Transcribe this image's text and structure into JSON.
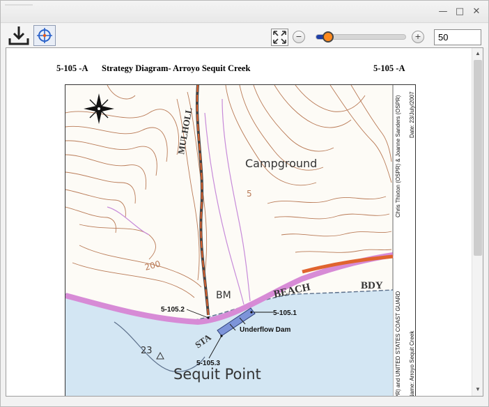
{
  "window": {
    "minimize_icon": "minimize-icon",
    "maximize_icon": "maximize-icon",
    "close_icon": "close-icon"
  },
  "toolbar": {
    "download_icon": "download-icon",
    "target_icon": "crosshair-icon",
    "fit_icon": "fit-to-screen-icon",
    "zoom_out_label": "−",
    "zoom_in_label": "+",
    "zoom_value": "50",
    "zoom_slider_fraction": 0.13
  },
  "document": {
    "header_left": "5-105 -A",
    "title": "Strategy Diagram- Arroyo Sequit Creek",
    "header_right": "5-105 -A"
  },
  "map": {
    "place_campground": "Campground",
    "place_sequit_point": "Sequit Point",
    "road_beach": "BEACH",
    "road_bdy": "BDY",
    "road_mulholland": "MULHOLL",
    "road_state": "STA",
    "bm": "BM",
    "contour_200": "200",
    "contour_23": "23",
    "contour_5": "5",
    "label_5_105_2": "5-105.2",
    "label_5_105_1": "5-105.1",
    "label_5_105_3": "5-105.3",
    "label_dam": "Underflow Dam",
    "side_date": "Date: 23/July/2007",
    "side_authors": "Chris Thixton (OSPR) & Joanne Sanders (OSPR)",
    "side_guard": "PR) and UNITED STATES COAST GUARD",
    "side_name": "Name: Arroyo Sequit Creek",
    "colors": {
      "contour": "#b97a56",
      "water": "#d3e6f3",
      "road": "#e0642f",
      "highway": "#d78bd6",
      "dam": "#7d94d9"
    }
  }
}
